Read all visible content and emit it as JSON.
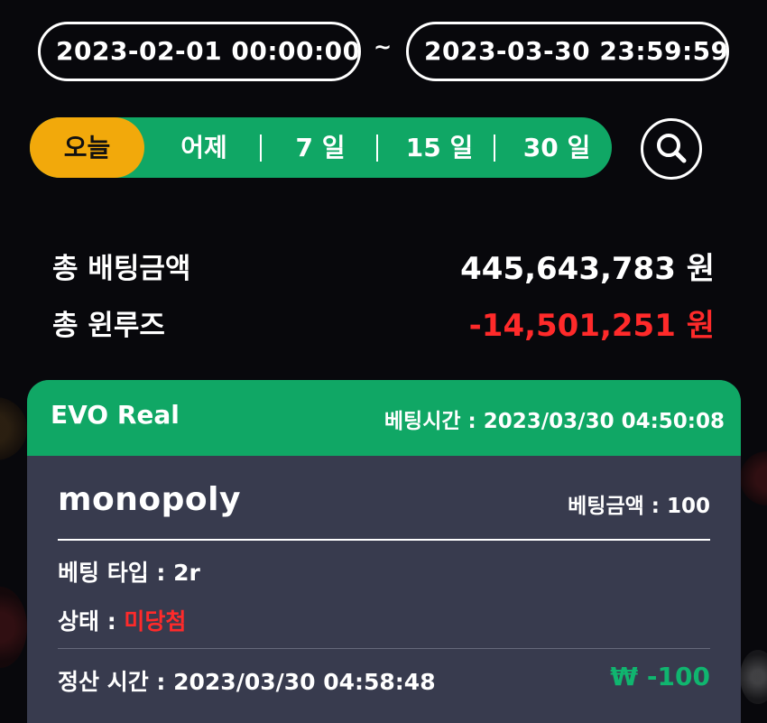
{
  "date_range": {
    "start": "2023-02-01 00:00:00",
    "separator": "~",
    "end": "2023-03-30 23:59:59"
  },
  "range_tabs": [
    {
      "label": "오늘",
      "active": true
    },
    {
      "label": "어제",
      "active": false
    },
    {
      "label": "7 일",
      "active": false
    },
    {
      "label": "15 일",
      "active": false
    },
    {
      "label": "30 일",
      "active": false
    }
  ],
  "search": {
    "icon": "search-icon"
  },
  "summary": {
    "total_bet_label": "총 배팅금액",
    "total_bet_value": "445,643,783 원",
    "total_winloss_label": "총 윈루즈",
    "total_winloss_value": "-14,501,251 원"
  },
  "bet_card": {
    "provider": "EVO Real",
    "bet_time": "베팅시간 : 2023/03/30 04:50:08",
    "game": "monopoly",
    "bet_amount": "베팅금액 :  100",
    "bet_type": "베팅 타입 :  2r",
    "status_label": "상태 : ",
    "status_value": "미당첨",
    "settle_time": "정산 시간 :  2023/03/30 04:58:48",
    "win_amount": "₩ -100"
  },
  "colors": {
    "background": "#08080c",
    "accent_green": "#10a765",
    "accent_yellow": "#f2a90b",
    "negative_red": "#ff2a2a",
    "card_bg": "#383b4e"
  }
}
